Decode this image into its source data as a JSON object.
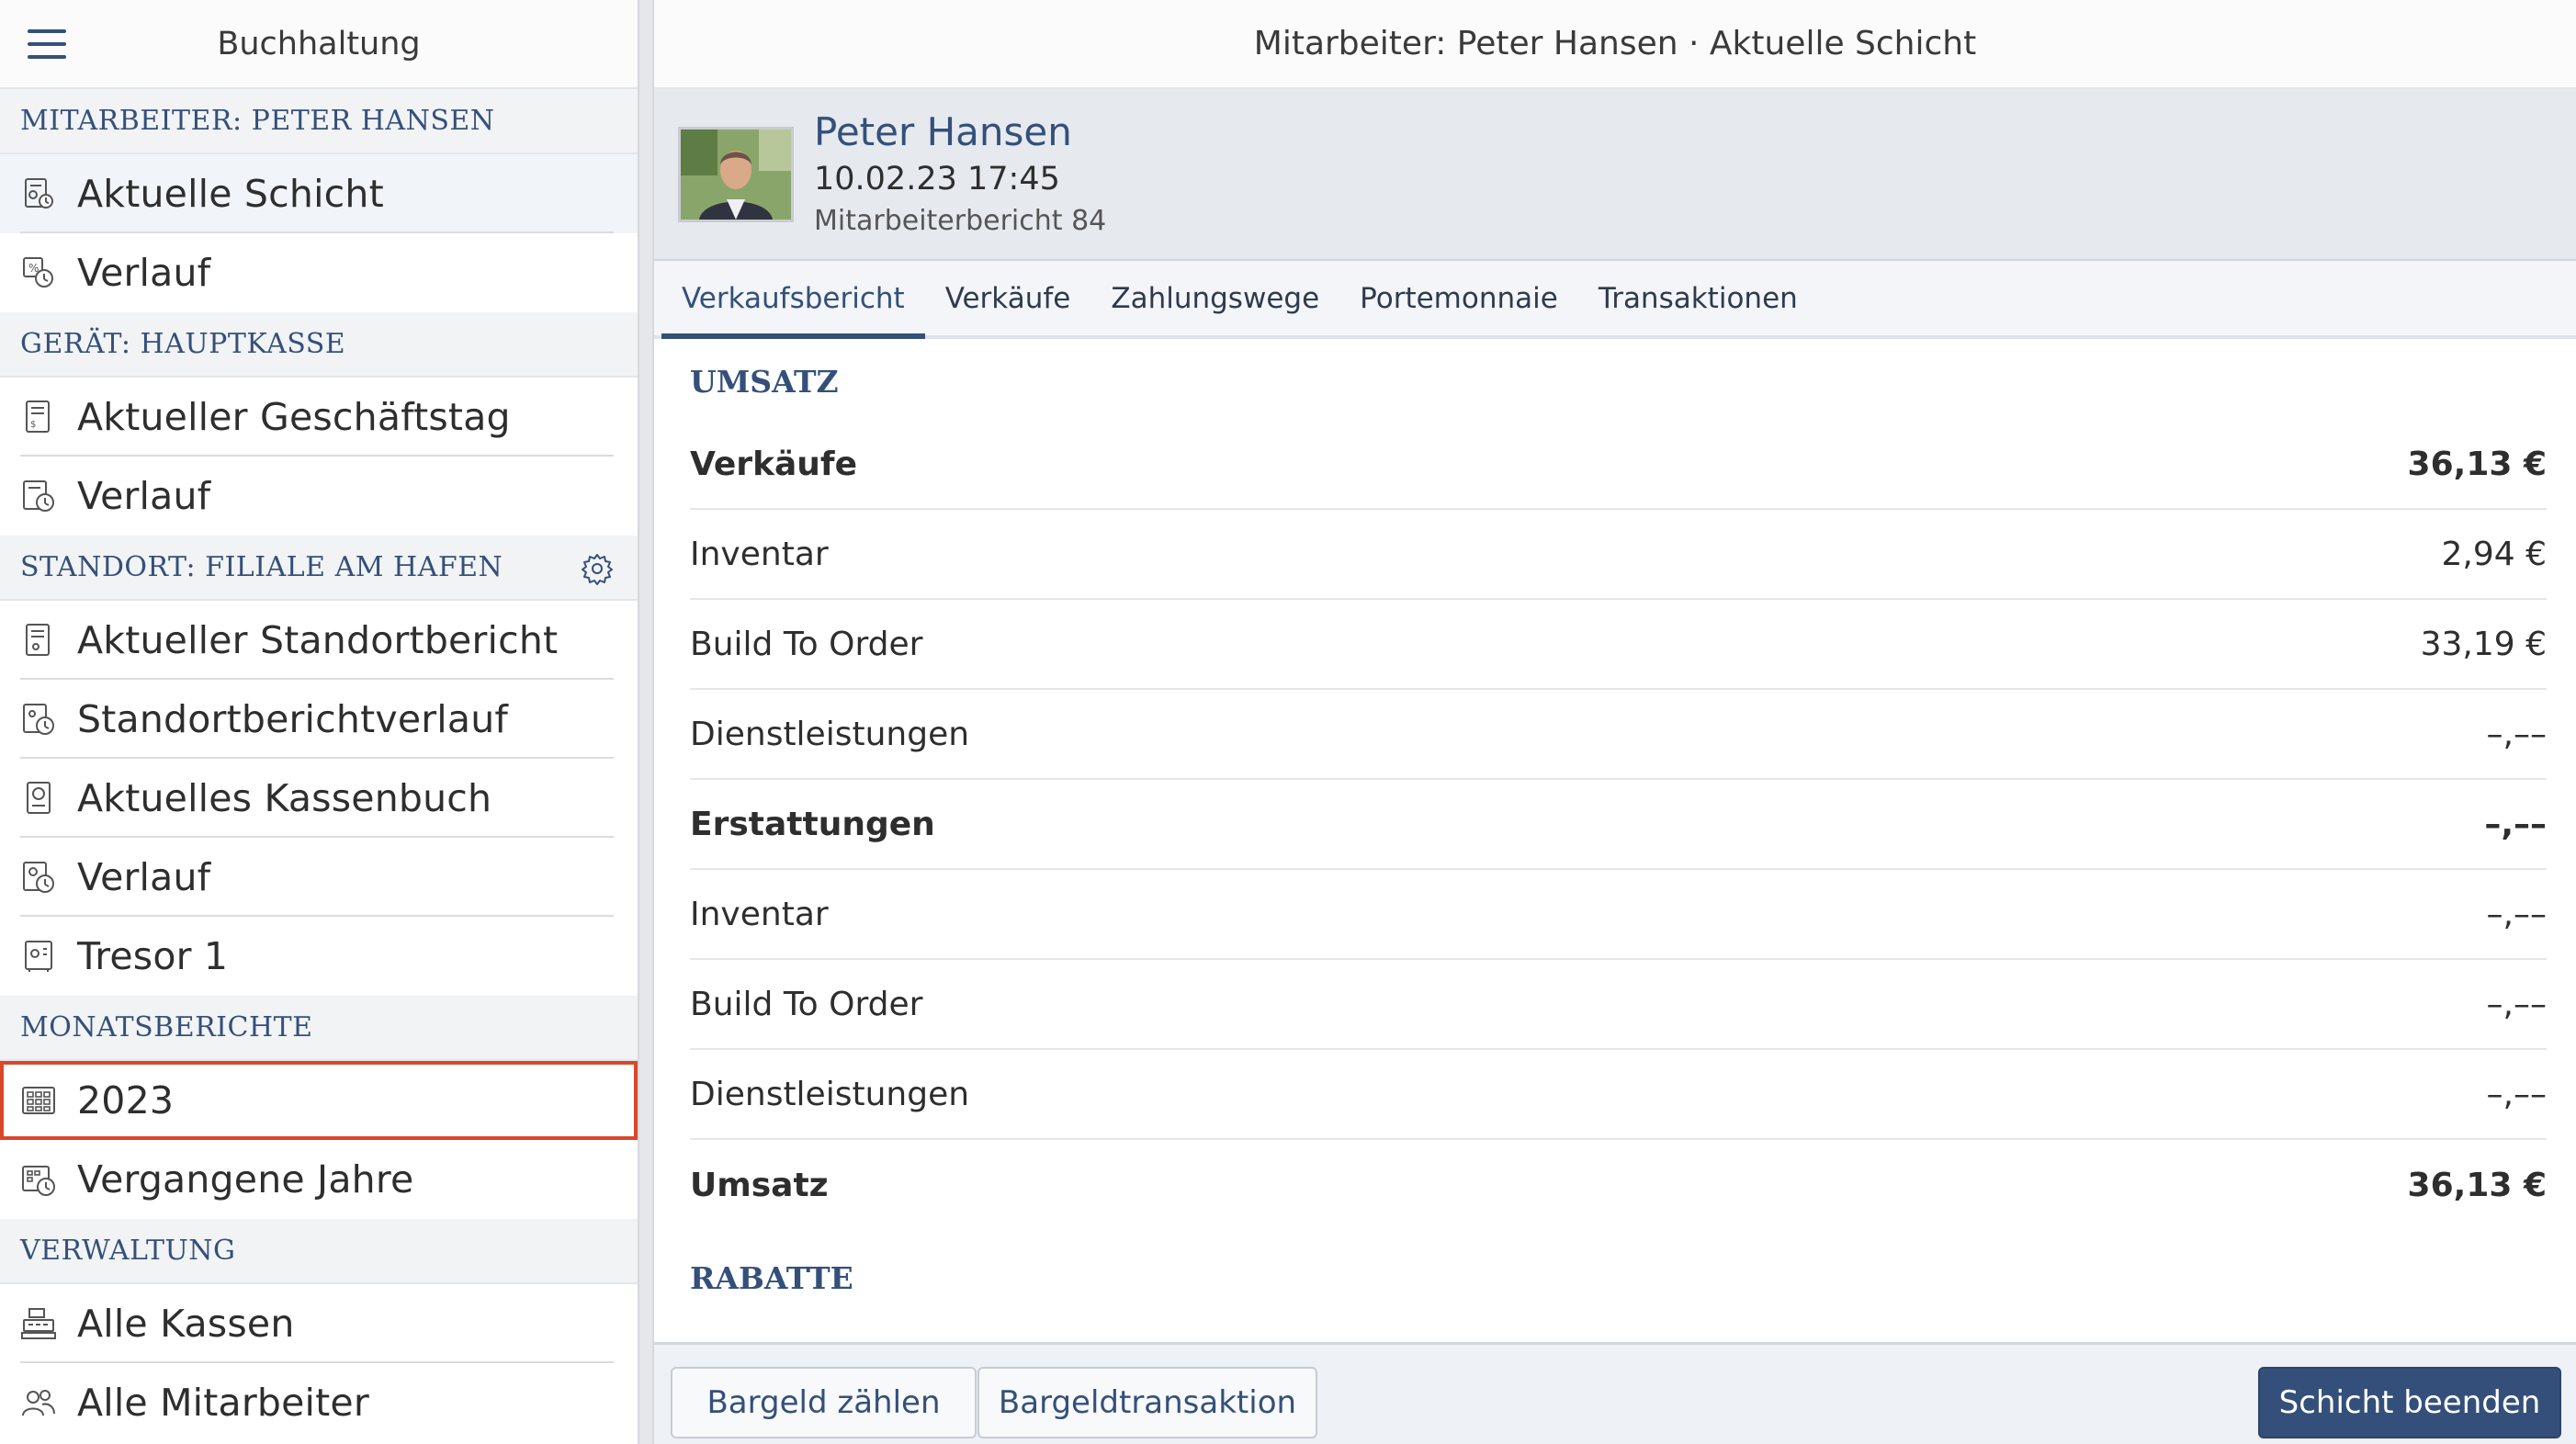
{
  "sidebar": {
    "title": "Buchhaltung",
    "sections": [
      {
        "label": "MITARBEITER: PETER HANSEN",
        "items": [
          {
            "label": "Aktuelle Schicht",
            "icon": "shift-report-icon"
          },
          {
            "label": "Verlauf",
            "icon": "history-icon"
          }
        ]
      },
      {
        "label": "GERÄT: HAUPTKASSE",
        "items": [
          {
            "label": "Aktueller Geschäftstag",
            "icon": "receipt-icon"
          },
          {
            "label": "Verlauf",
            "icon": "history-icon"
          }
        ]
      },
      {
        "label": "STANDORT: FILIALE AM HAFEN",
        "items": [
          {
            "label": "Aktueller Standortbericht",
            "icon": "location-report-icon"
          },
          {
            "label": "Standortberichtverlauf",
            "icon": "history-icon"
          },
          {
            "label": "Aktuelles Kassenbuch",
            "icon": "cashbook-icon"
          },
          {
            "label": "Verlauf",
            "icon": "history-icon"
          },
          {
            "label": "Tresor 1",
            "icon": "safe-icon"
          }
        ]
      },
      {
        "label": "MONATSBERICHTE",
        "items": [
          {
            "label": "2023",
            "icon": "calendar-grid-icon"
          },
          {
            "label": "Vergangene Jahre",
            "icon": "calendar-history-icon"
          }
        ]
      },
      {
        "label": "VERWALTUNG",
        "items": [
          {
            "label": "Alle Kassen",
            "icon": "cash-register-icon"
          },
          {
            "label": "Alle Mitarbeiter",
            "icon": "users-icon"
          }
        ]
      }
    ]
  },
  "topbar": {
    "title": "Mitarbeiter: Peter Hansen · Aktuelle Schicht"
  },
  "profile": {
    "name": "Peter Hansen",
    "datetime": "10.02.23 17:45",
    "report": "Mitarbeiterbericht 84"
  },
  "tabs": [
    "Verkaufsbericht",
    "Verkäufe",
    "Zahlungswege",
    "Portemonnaie",
    "Transaktionen"
  ],
  "report": {
    "umsatz_title": "UMSATZ",
    "rows": [
      {
        "label": "Verkäufe",
        "value": "36,13 €"
      },
      {
        "label": "Inventar",
        "value": "2,94 €"
      },
      {
        "label": "Build To Order",
        "value": "33,19 €"
      },
      {
        "label": "Dienstleistungen",
        "value": "–,––"
      },
      {
        "label": "Erstattungen",
        "value": "–,––"
      },
      {
        "label": "Inventar",
        "value": "–,––"
      },
      {
        "label": "Build To Order",
        "value": "–,––"
      },
      {
        "label": "Dienstleistungen",
        "value": "–,––"
      },
      {
        "label": "Umsatz",
        "value": "36,13 €"
      }
    ],
    "rabatte_title": "RABATTE"
  },
  "footer": {
    "count_cash": "Bargeld zählen",
    "cash_transaction": "Bargeldtransaktion",
    "end_shift": "Schicht beenden"
  },
  "colors": {
    "accent": "#34507a",
    "highlight": "#d9472b"
  }
}
